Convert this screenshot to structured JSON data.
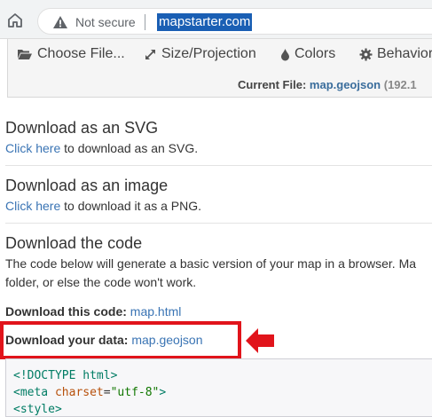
{
  "browser": {
    "security_label": "Not secure",
    "url": "mapstarter.com"
  },
  "toolbar": {
    "items": [
      {
        "label": "Choose File...",
        "icon": "folder-open-icon"
      },
      {
        "label": "Size/Projection",
        "icon": "expand-arrows-icon"
      },
      {
        "label": "Colors",
        "icon": "tint-drop-icon"
      },
      {
        "label": "Behavior",
        "icon": "gear-icon"
      }
    ]
  },
  "infobar": {
    "current_file_label": "Current File:",
    "file_name": "map.geojson",
    "extra": "(192.1"
  },
  "sections": {
    "svg": {
      "title": "Download as an SVG",
      "link": "Click here",
      "text": " to download as an SVG."
    },
    "image": {
      "title": "Download as an image",
      "link": "Click here",
      "text": " to download it as a PNG."
    },
    "code": {
      "title": "Download the code",
      "text_line1": "The code below will generate a basic version of your map in a browser. Ma",
      "text_line2": "folder, or else the code won't work."
    }
  },
  "downloads": {
    "code_label": "Download this code:",
    "code_file": "map.html",
    "data_label": "Download your data:",
    "data_file": "map.geojson"
  },
  "code_block": {
    "line1": "<!DOCTYPE html>",
    "line2_tag_open": "<meta ",
    "line2_attr": "charset",
    "line2_eq": "=",
    "line2_str": "\"utf-8\"",
    "line2_tag_close": ">",
    "line3": "<style>"
  },
  "colors": {
    "link": "#3a74b4",
    "highlight": "#e1141b",
    "url_selection": "#1a5fb4"
  }
}
